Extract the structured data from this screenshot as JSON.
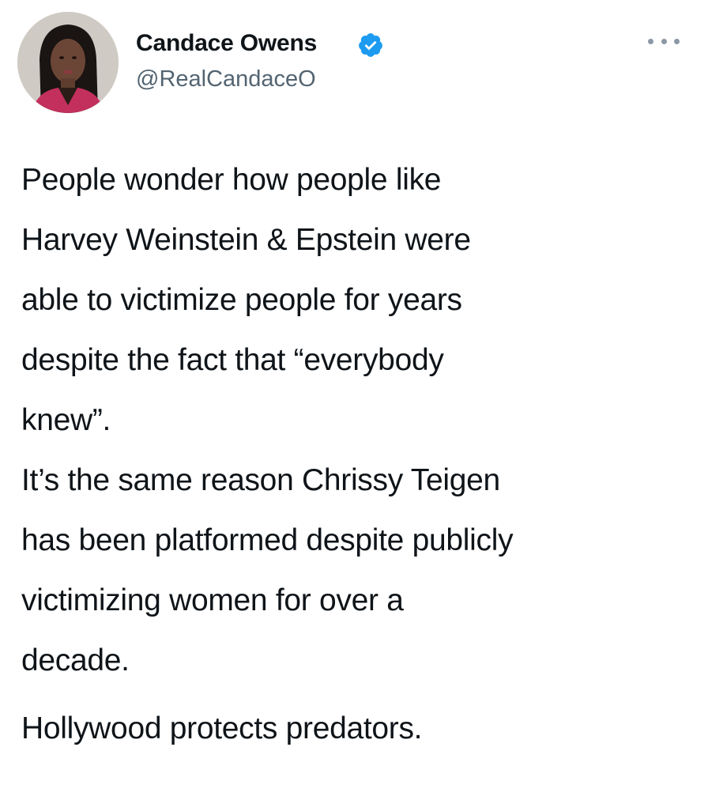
{
  "tweet": {
    "author": {
      "name": "Candace Owens",
      "handle": "@RealCandaceO",
      "verified": true,
      "verified_color": "#1d9bf0"
    },
    "menu_icon": "more-horizontal-icon",
    "body_lines": [
      "People wonder how people like",
      "Harvey Weinstein &  Epstein were",
      "able to victimize people for years",
      "despite the fact that “everybody",
      "knew”.",
      "It’s the same reason Chrissy Teigen",
      "has been platformed despite publicly",
      "victimizing women for over a",
      "decade.",
      "Hollywood protects predators."
    ]
  }
}
